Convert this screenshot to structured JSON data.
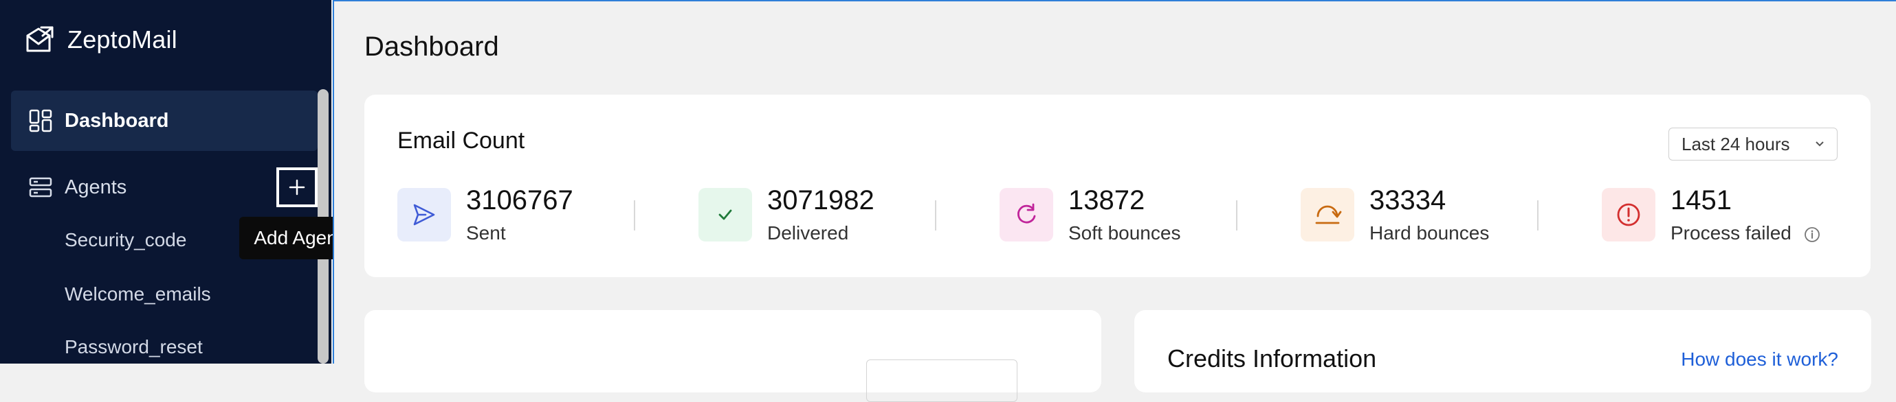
{
  "app": {
    "name": "ZeptoMail"
  },
  "sidebar": {
    "dashboard_label": "Dashboard",
    "agents_label": "Agents",
    "add_agent_tooltip": "Add Agent",
    "agents": [
      "Security_code",
      "Welcome_emails",
      "Password_reset"
    ]
  },
  "page": {
    "title": "Dashboard"
  },
  "email_count": {
    "title": "Email Count",
    "range": "Last 24 hours",
    "stats": [
      {
        "value": "3106767",
        "label": "Sent",
        "icon": "send-icon",
        "bg": "#e8edfb",
        "color": "#3f5bd6"
      },
      {
        "value": "3071982",
        "label": "Delivered",
        "icon": "check-icon",
        "bg": "#e6f7ec",
        "color": "#1f7a3a"
      },
      {
        "value": "13872",
        "label": "Soft bounces",
        "icon": "refresh-icon",
        "bg": "#fbe6f2",
        "color": "#c0249a"
      },
      {
        "value": "33334",
        "label": "Hard bounces",
        "icon": "bounce-icon",
        "bg": "#fdf0e3",
        "color": "#c86a10"
      },
      {
        "value": "1451",
        "label": "Process failed",
        "icon": "alert-icon",
        "bg": "#fde7e7",
        "color": "#d32f2f"
      }
    ]
  },
  "credits": {
    "title": "Credits Information",
    "help_link": "How does it work?"
  }
}
